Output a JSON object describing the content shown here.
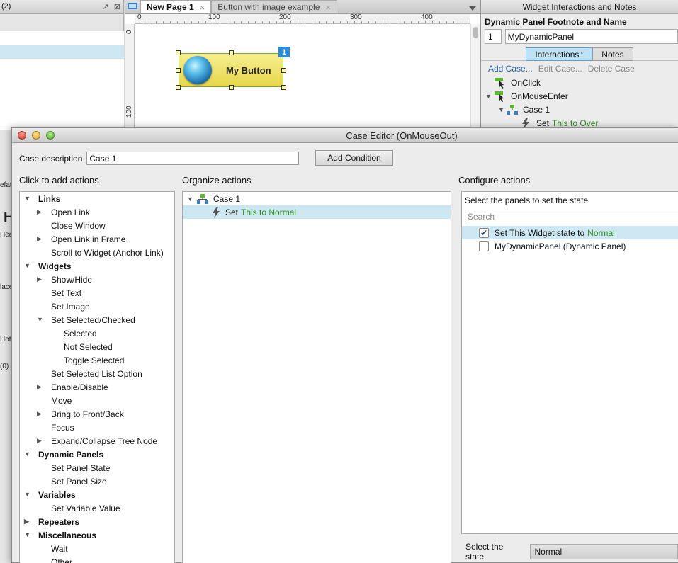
{
  "left_pane": {
    "header_text": "(2)",
    "fragments": [
      "efau",
      "H",
      "Hea",
      "lace",
      "Hot",
      "(0)"
    ]
  },
  "tabs": [
    {
      "label": "New Page 1",
      "active": true
    },
    {
      "label": "Button with image example",
      "active": false
    }
  ],
  "rulers": {
    "horizontal": [
      "0",
      "100",
      "200",
      "300",
      "400"
    ],
    "vertical": [
      "0",
      "100"
    ]
  },
  "canvas": {
    "button_label": "My Button",
    "badge": "1"
  },
  "interactions_panel": {
    "title": "Widget Interactions and Notes",
    "footnote_label": "Dynamic Panel Footnote and Name",
    "footnote_number": "1",
    "panel_name": "MyDynamicPanel",
    "tabs": [
      {
        "label": "Interactions",
        "modified": "*",
        "active": true
      },
      {
        "label": "Notes",
        "active": false
      }
    ],
    "actions": {
      "add": "Add Case...",
      "edit": "Edit Case...",
      "delete": "Delete Case"
    },
    "tree": [
      {
        "label": "OnClick",
        "type": "event",
        "level": 0
      },
      {
        "label": "OnMouseEnter",
        "type": "event",
        "level": 0,
        "expanded": true
      },
      {
        "label": "Case 1",
        "type": "case",
        "level": 1,
        "expanded": true
      },
      {
        "label": "Set",
        "target": "This to Over",
        "type": "action",
        "level": 2
      }
    ]
  },
  "dialog": {
    "title": "Case Editor (OnMouseOut)",
    "case_description_label": "Case description",
    "case_description_value": "Case 1",
    "add_condition": "Add Condition",
    "col_titles": {
      "add_actions": "Click to add actions",
      "organize": "Organize actions",
      "configure": "Configure actions"
    },
    "action_tree": [
      {
        "label": "Links",
        "level": 0,
        "bold": true,
        "tri": "down"
      },
      {
        "label": "Open Link",
        "level": 1,
        "tri": "right"
      },
      {
        "label": "Close Window",
        "level": 1
      },
      {
        "label": "Open Link in Frame",
        "level": 1,
        "tri": "right"
      },
      {
        "label": "Scroll to Widget (Anchor Link)",
        "level": 1
      },
      {
        "label": "Widgets",
        "level": 0,
        "bold": true,
        "tri": "down"
      },
      {
        "label": "Show/Hide",
        "level": 1,
        "tri": "right"
      },
      {
        "label": "Set Text",
        "level": 1
      },
      {
        "label": "Set Image",
        "level": 1
      },
      {
        "label": "Set Selected/Checked",
        "level": 1,
        "tri": "down"
      },
      {
        "label": "Selected",
        "level": 2
      },
      {
        "label": "Not Selected",
        "level": 2
      },
      {
        "label": "Toggle Selected",
        "level": 2
      },
      {
        "label": "Set Selected List Option",
        "level": 1
      },
      {
        "label": "Enable/Disable",
        "level": 1,
        "tri": "right"
      },
      {
        "label": "Move",
        "level": 1
      },
      {
        "label": "Bring to Front/Back",
        "level": 1,
        "tri": "right"
      },
      {
        "label": "Focus",
        "level": 1
      },
      {
        "label": "Expand/Collapse Tree Node",
        "level": 1,
        "tri": "right"
      },
      {
        "label": "Dynamic Panels",
        "level": 0,
        "bold": true,
        "tri": "down"
      },
      {
        "label": "Set Panel State",
        "level": 1
      },
      {
        "label": "Set Panel Size",
        "level": 1
      },
      {
        "label": "Variables",
        "level": 0,
        "bold": true,
        "tri": "down"
      },
      {
        "label": "Set Variable Value",
        "level": 1
      },
      {
        "label": "Repeaters",
        "level": 0,
        "bold": true,
        "tri": "right"
      },
      {
        "label": "Miscellaneous",
        "level": 0,
        "bold": true,
        "tri": "down"
      },
      {
        "label": "Wait",
        "level": 1
      },
      {
        "label": "Other",
        "level": 1
      }
    ],
    "organize": {
      "case_label": "Case 1",
      "action_prefix": "Set",
      "action_target": "This to Normal"
    },
    "configure": {
      "select_panels_label": "Select the panels to set the state",
      "search_placeholder": "Search",
      "items": [
        {
          "prefix": "Set This Widget state to",
          "state": "Normal",
          "checked": true
        },
        {
          "prefix": "MyDynamicPanel (Dynamic Panel)",
          "state": "",
          "checked": false
        }
      ],
      "select_state_label": "Select the state",
      "selected_state": "Normal"
    }
  },
  "colors": {
    "selection": "#cde8f3",
    "green_text": "#2e8a1e",
    "link_blue": "#2866a8",
    "badge_blue": "#2a8bd6"
  }
}
